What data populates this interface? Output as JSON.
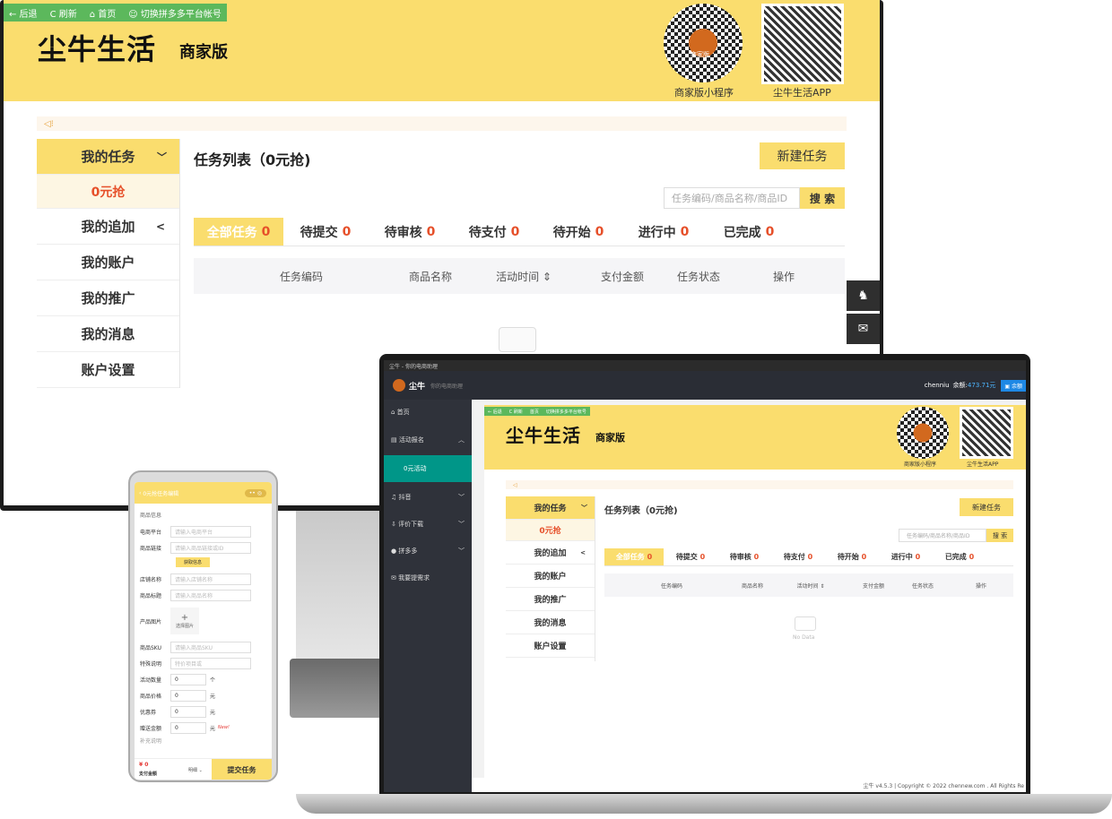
{
  "toolbar": {
    "back": "← 后退",
    "refresh": "C 刷新",
    "home": "首页",
    "switch": "切换拼多多平台帐号"
  },
  "brand": {
    "logo": "尘牛生活",
    "edition": "商家版",
    "mini_label": "商家版小程序",
    "app_label": "尘牛生活APP",
    "mini_badge": "商家版"
  },
  "sidebar": {
    "items": [
      {
        "label": "我的任务",
        "arrow": "﹀"
      },
      {
        "label": "0元抢"
      },
      {
        "label": "我的追加",
        "arrow": "<"
      },
      {
        "label": "我的账户"
      },
      {
        "label": "我的推广"
      },
      {
        "label": "我的消息"
      },
      {
        "label": "账户设置"
      }
    ]
  },
  "main": {
    "title": "任务列表（0元抢)",
    "new_task": "新建任务",
    "search_placeholder": "任务编码/商品名称/商品ID",
    "search_btn": "搜 索",
    "no_data": "No Data"
  },
  "tabs": [
    {
      "label": "全部任务",
      "count": "0"
    },
    {
      "label": "待提交",
      "count": "0"
    },
    {
      "label": "待审核",
      "count": "0"
    },
    {
      "label": "待支付",
      "count": "0"
    },
    {
      "label": "待开始",
      "count": "0"
    },
    {
      "label": "进行中",
      "count": "0"
    },
    {
      "label": "已完成",
      "count": "0"
    }
  ],
  "table": {
    "cols": [
      "任务编码",
      "商品名称",
      "活动时间 ⇕",
      "支付金额",
      "任务状态",
      "操作"
    ]
  },
  "laptop": {
    "title_bar": "尘牛 - 你的电商助理",
    "app": "尘牛",
    "slogan": "你的电商助理",
    "user": "chenniu",
    "balance_label": "余额:",
    "balance": "473.71元",
    "cart": "余额",
    "nav": [
      {
        "label": "首页"
      },
      {
        "label": "活动报名"
      },
      {
        "label": "0元活动"
      },
      {
        "label": "抖音"
      },
      {
        "label": "评价下载"
      },
      {
        "label": "拼多多"
      },
      {
        "label": "我要提需求"
      }
    ],
    "footer": "尘牛 v4.5.3 | Copyright © 2022 chennew.com . All Rights Re"
  },
  "phone": {
    "title": "0元抢任务编辑",
    "section": "商品信息",
    "fields": [
      {
        "label": "电商平台",
        "ph": "请输入电商平台"
      },
      {
        "label": "商品链接",
        "ph": "请输入商品链接或ID"
      },
      {
        "label": "店铺名称",
        "ph": "请输入店铺名称"
      },
      {
        "label": "商品标题",
        "ph": "请输入商品名称"
      },
      {
        "label": "商品SKU",
        "ph": "请输入商品SKU"
      },
      {
        "label": "特殊说明",
        "ph": "特价项目或"
      },
      {
        "label": "活动数量",
        "ph": "0",
        "unit": "个"
      },
      {
        "label": "商品价格",
        "ph": "0",
        "unit": "元"
      },
      {
        "label": "优惠券",
        "ph": "0",
        "unit": "元"
      },
      {
        "label": "赠送金额",
        "ph": "0",
        "unit": "元"
      }
    ],
    "get_info": "获取信息",
    "image_label": "产品图片",
    "choose_image": "选择图片",
    "new_badge": "New!",
    "price": "¥ 0",
    "pay_label": "支付金额",
    "detail": "明细 ⌄",
    "submit": "提交任务",
    "extra": "补充说明"
  }
}
